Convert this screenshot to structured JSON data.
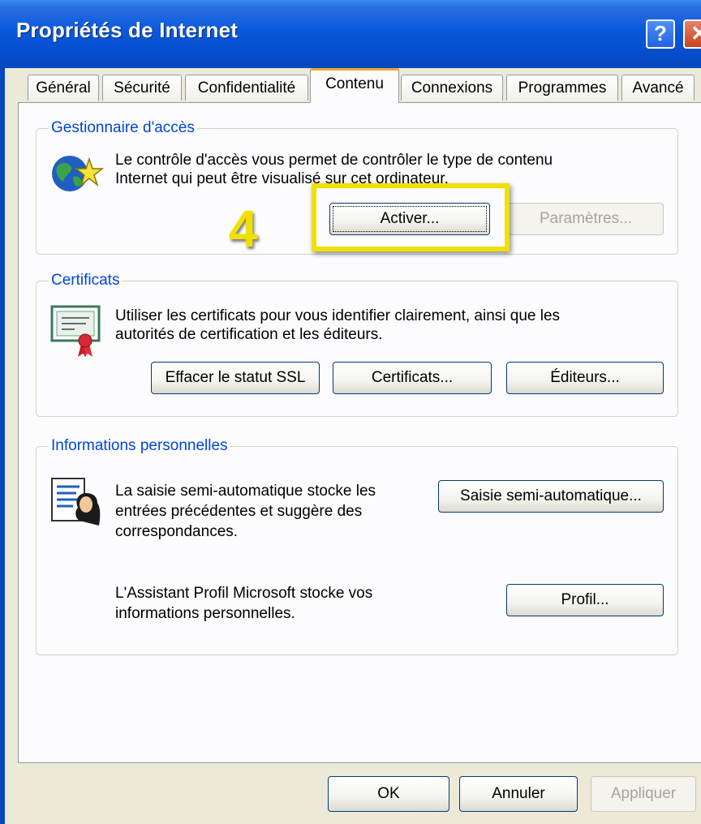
{
  "window": {
    "title": "Propriétés de Internet",
    "help_glyph": "?",
    "close_glyph": "✕"
  },
  "tabs": [
    {
      "label": "Général",
      "active": false
    },
    {
      "label": "Sécurité",
      "active": false
    },
    {
      "label": "Confidentialité",
      "active": false
    },
    {
      "label": "Contenu",
      "active": true
    },
    {
      "label": "Connexions",
      "active": false
    },
    {
      "label": "Programmes",
      "active": false
    },
    {
      "label": "Avancé",
      "active": false
    }
  ],
  "access_manager": {
    "legend": "Gestionnaire d'accès",
    "icon": "globe-star-icon",
    "desc_line1": "Le contrôle d'accès vous permet de contrôler le type de contenu",
    "desc_line2": "Internet qui peut être visualisé sur cet ordinateur.",
    "enable_button": "Activer...",
    "settings_button": "Paramètres..."
  },
  "annotation": {
    "step_number": "4",
    "highlight_color": "#F0E000"
  },
  "certificates": {
    "legend": "Certificats",
    "icon": "certificate-icon",
    "desc_line1": "Utiliser les certificats pour vous identifier clairement, ainsi que les",
    "desc_line2": "autorités de certification et les éditeurs.",
    "clear_ssl_button": "Effacer le statut SSL",
    "certificates_button": "Certificats...",
    "publishers_button": "Éditeurs..."
  },
  "personal_info": {
    "legend": "Informations personnelles",
    "icon": "autocomplete-icon",
    "autocomplete_line1": "La saisie semi-automatique stocke les",
    "autocomplete_line2": "entrées précédentes et suggère des",
    "autocomplete_line3": "correspondances.",
    "autocomplete_button": "Saisie semi-automatique...",
    "profile_line1": "L'Assistant Profil Microsoft stocke vos",
    "profile_line2": "informations personnelles.",
    "profile_button": "Profil..."
  },
  "footer": {
    "ok_button": "OK",
    "cancel_button": "Annuler",
    "apply_button": "Appliquer"
  },
  "colors": {
    "titlebar": "#0A58DD",
    "dialog_bg": "#ECE9D8",
    "group_label": "#0046D5",
    "annotation": "#F0E000"
  }
}
